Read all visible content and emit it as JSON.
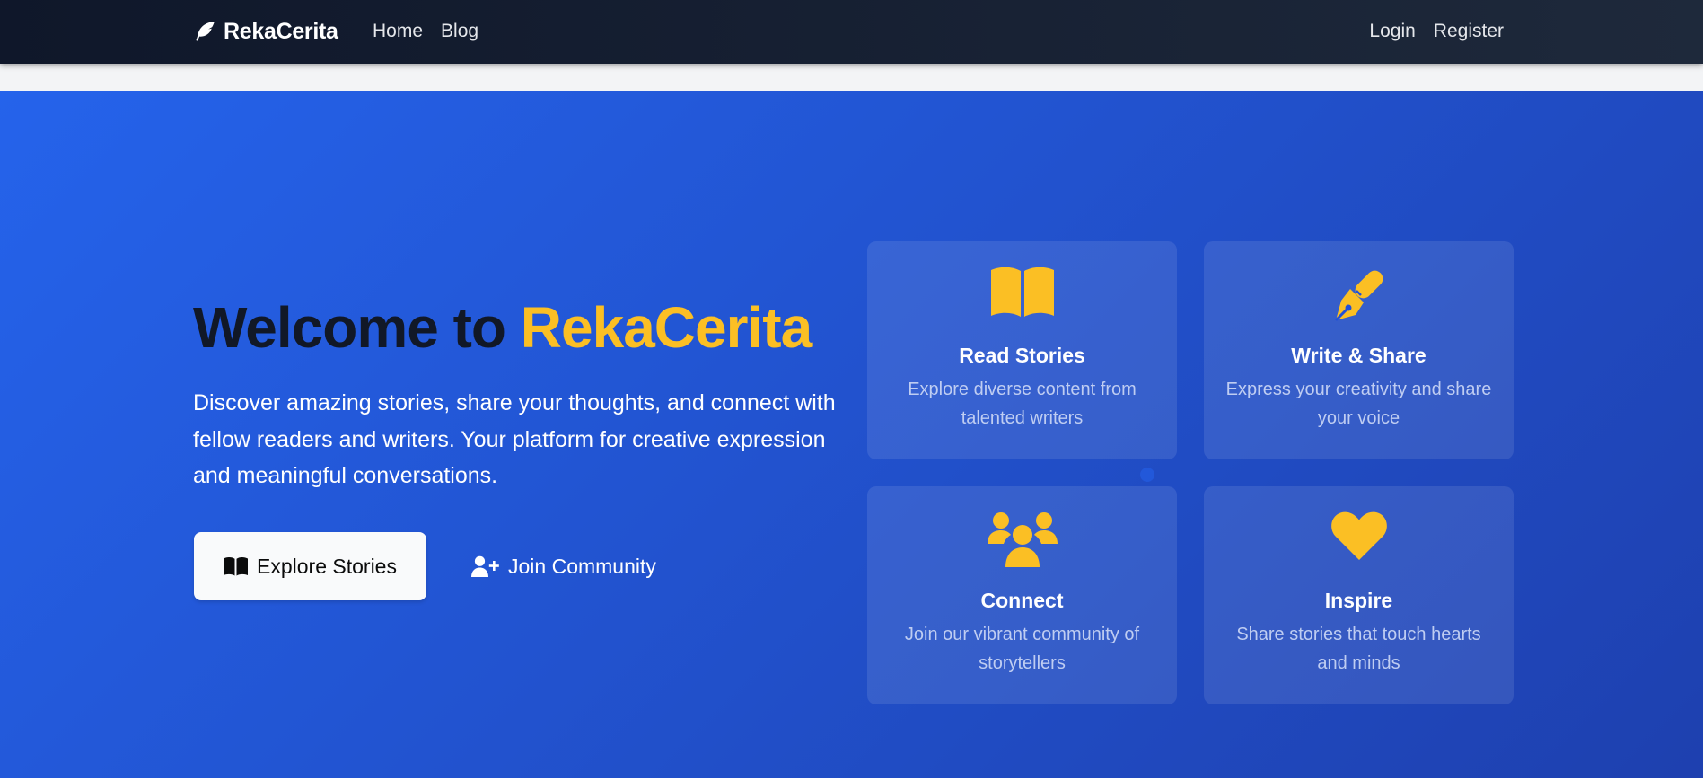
{
  "navbar": {
    "brand": "RekaCerita",
    "brand_icon": "feather-icon",
    "links_left": [
      "Home",
      "Blog"
    ],
    "links_right": [
      "Login",
      "Register"
    ]
  },
  "hero": {
    "title_part1": "Welcome to",
    "title_part2": "RekaCerita",
    "description": "Discover amazing stories, share your thoughts, and connect with fellow readers and writers. Your platform for creative expression and meaningful conversations.",
    "primary_button": {
      "label": "Explore Stories",
      "icon": "book-open-icon"
    },
    "secondary_button": {
      "label": "Join Community",
      "icon": "user-plus-icon"
    }
  },
  "features": [
    {
      "title": "Read Stories",
      "description": "Explore diverse content from talented writers",
      "icon": "book-open-icon"
    },
    {
      "title": "Write & Share",
      "description": "Express your creativity and share your voice",
      "icon": "pen-nib-icon"
    },
    {
      "title": "Connect",
      "description": "Join our vibrant community of storytellers",
      "icon": "users-icon"
    },
    {
      "title": "Inspire",
      "description": "Share stories that touch hearts and minds",
      "icon": "heart-icon"
    }
  ],
  "colors": {
    "navbar": "#0f172a",
    "hero_gradient_start": "#2563eb",
    "hero_gradient_end": "#1e40af",
    "accent": "#fbbf24",
    "title_dark": "#111827"
  }
}
